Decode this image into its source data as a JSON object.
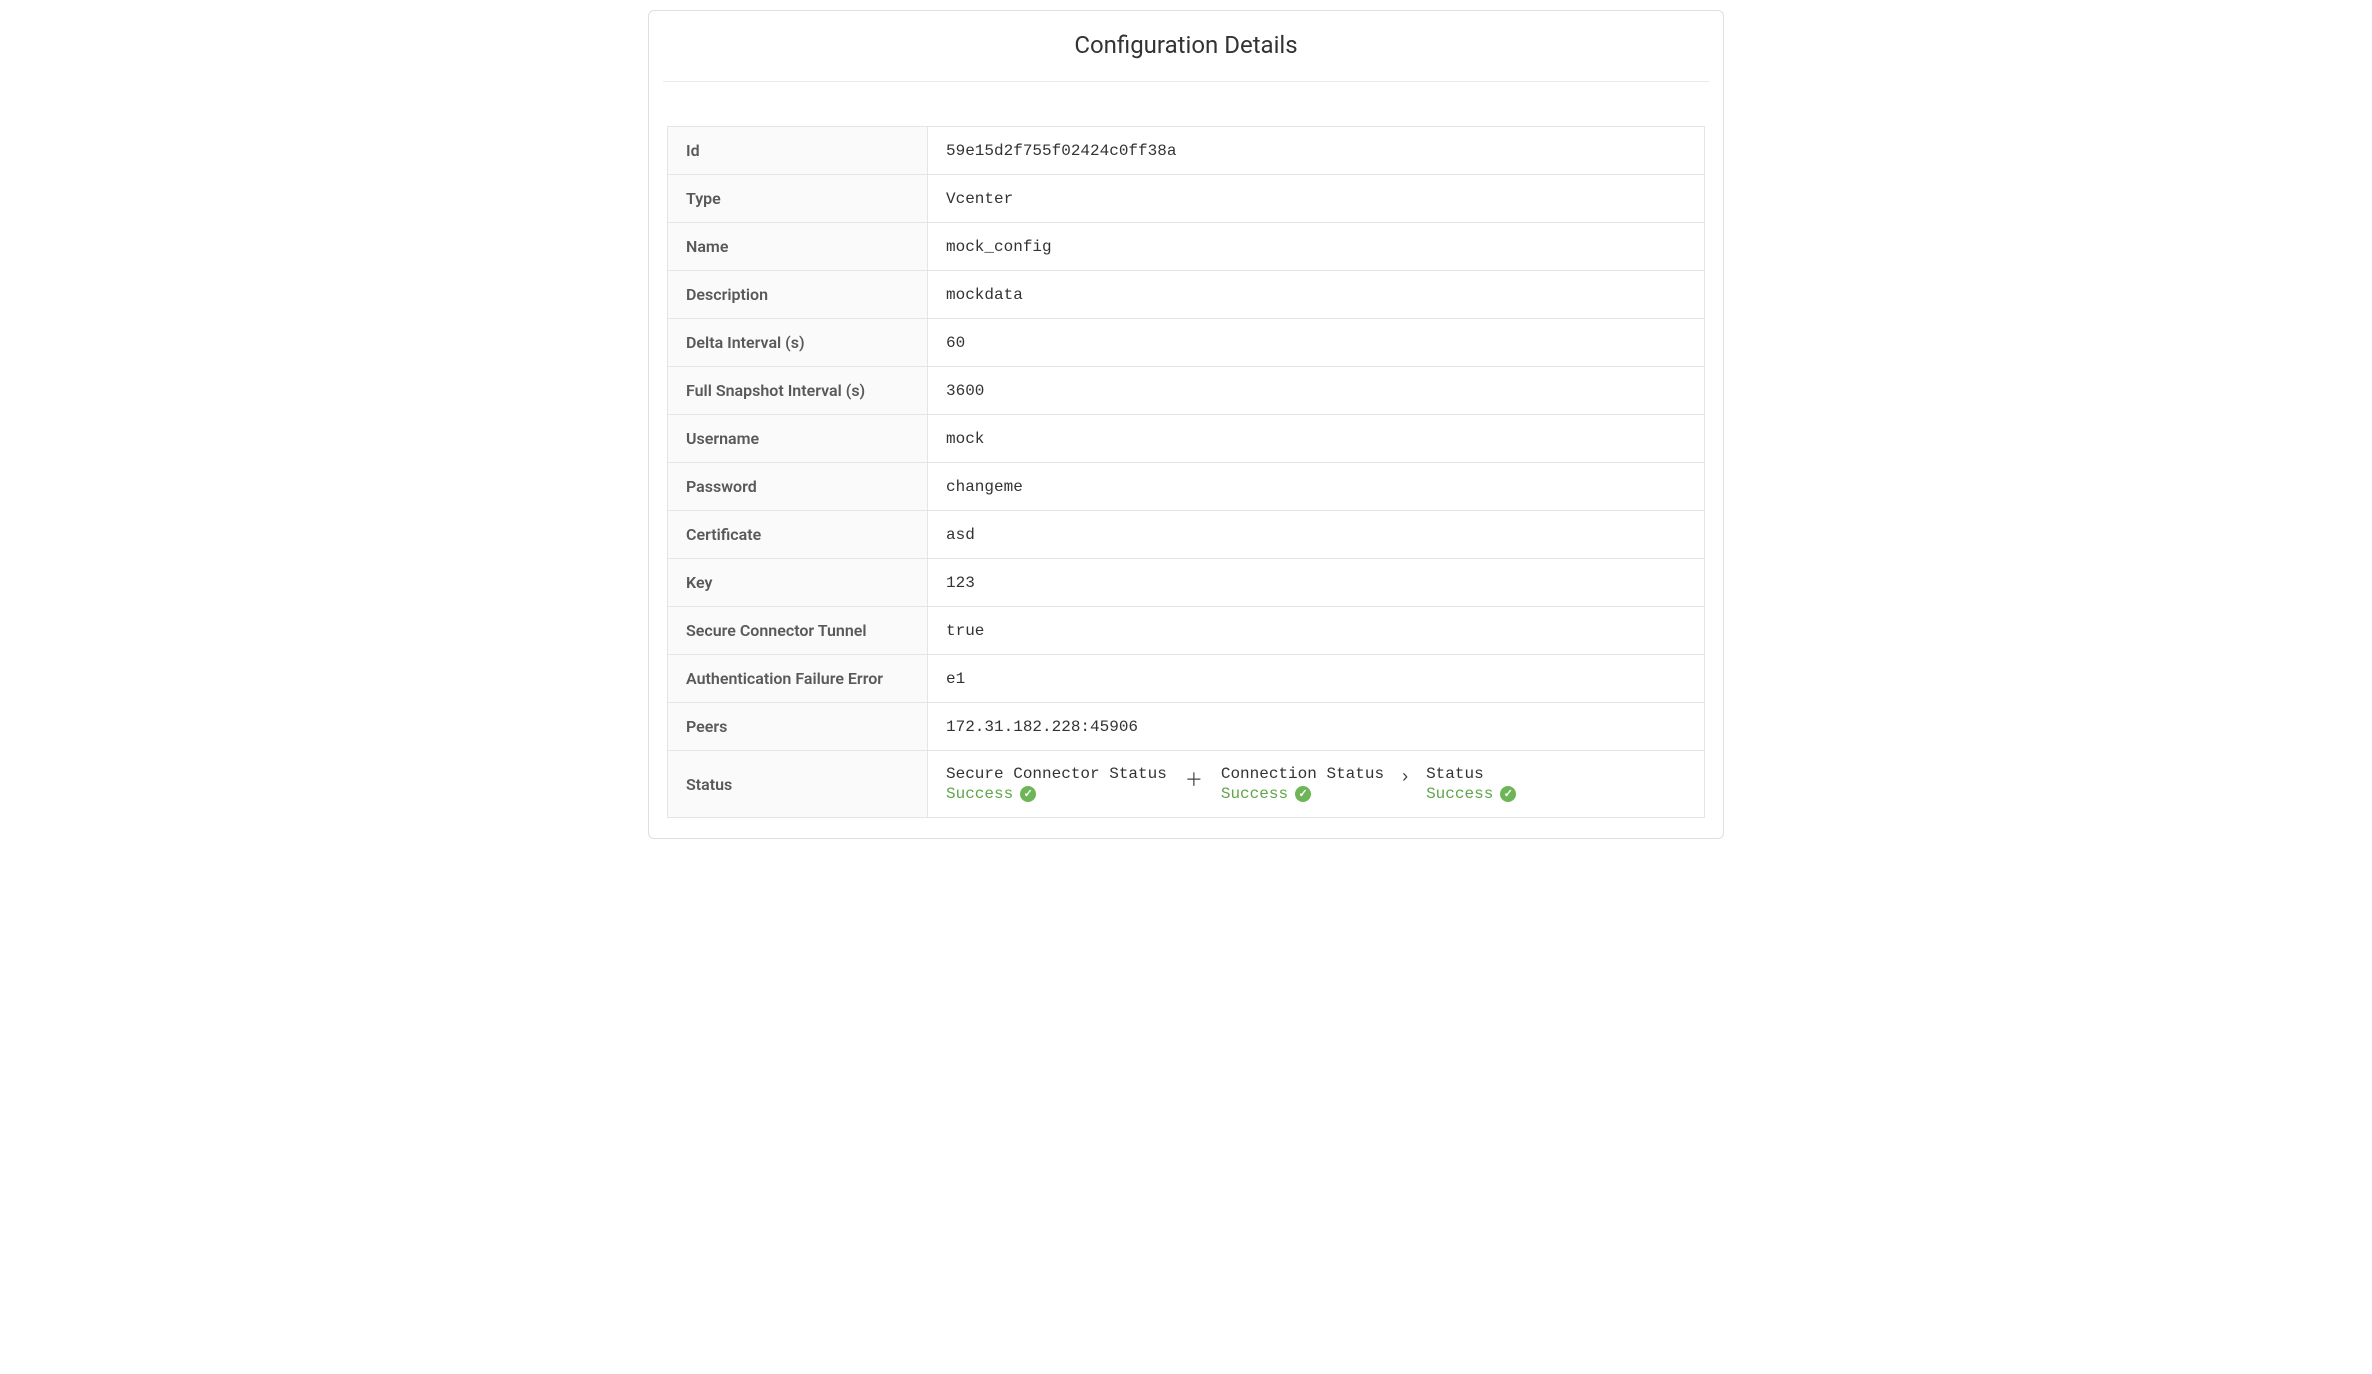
{
  "title": "Configuration Details",
  "rows": {
    "id": {
      "label": "Id",
      "value": "59e15d2f755f02424c0ff38a"
    },
    "type": {
      "label": "Type",
      "value": "Vcenter"
    },
    "name": {
      "label": "Name",
      "value": "mock_config"
    },
    "desc": {
      "label": "Description",
      "value": "mockdata"
    },
    "delta": {
      "label": "Delta Interval (s)",
      "value": "60"
    },
    "snap": {
      "label": "Full Snapshot Interval (s)",
      "value": "3600"
    },
    "user": {
      "label": "Username",
      "value": "mock"
    },
    "pass": {
      "label": "Password",
      "value": "changeme"
    },
    "cert": {
      "label": "Certificate",
      "value": "asd"
    },
    "key": {
      "label": "Key",
      "value": "123"
    },
    "tunnel": {
      "label": "Secure Connector Tunnel",
      "value": "true"
    },
    "auth_err": {
      "label": "Authentication Failure Error",
      "value": "e1"
    },
    "peers": {
      "label": "Peers",
      "value": "172.31.182.228:45906"
    },
    "status": {
      "label": "Status"
    }
  },
  "status": {
    "secure_connector": {
      "label": "Secure Connector Status",
      "value": "Success"
    },
    "connection": {
      "label": "Connection Status",
      "value": "Success"
    },
    "overall": {
      "label": "Status",
      "value": "Success"
    },
    "sep1": "＋",
    "sep2": "›"
  }
}
